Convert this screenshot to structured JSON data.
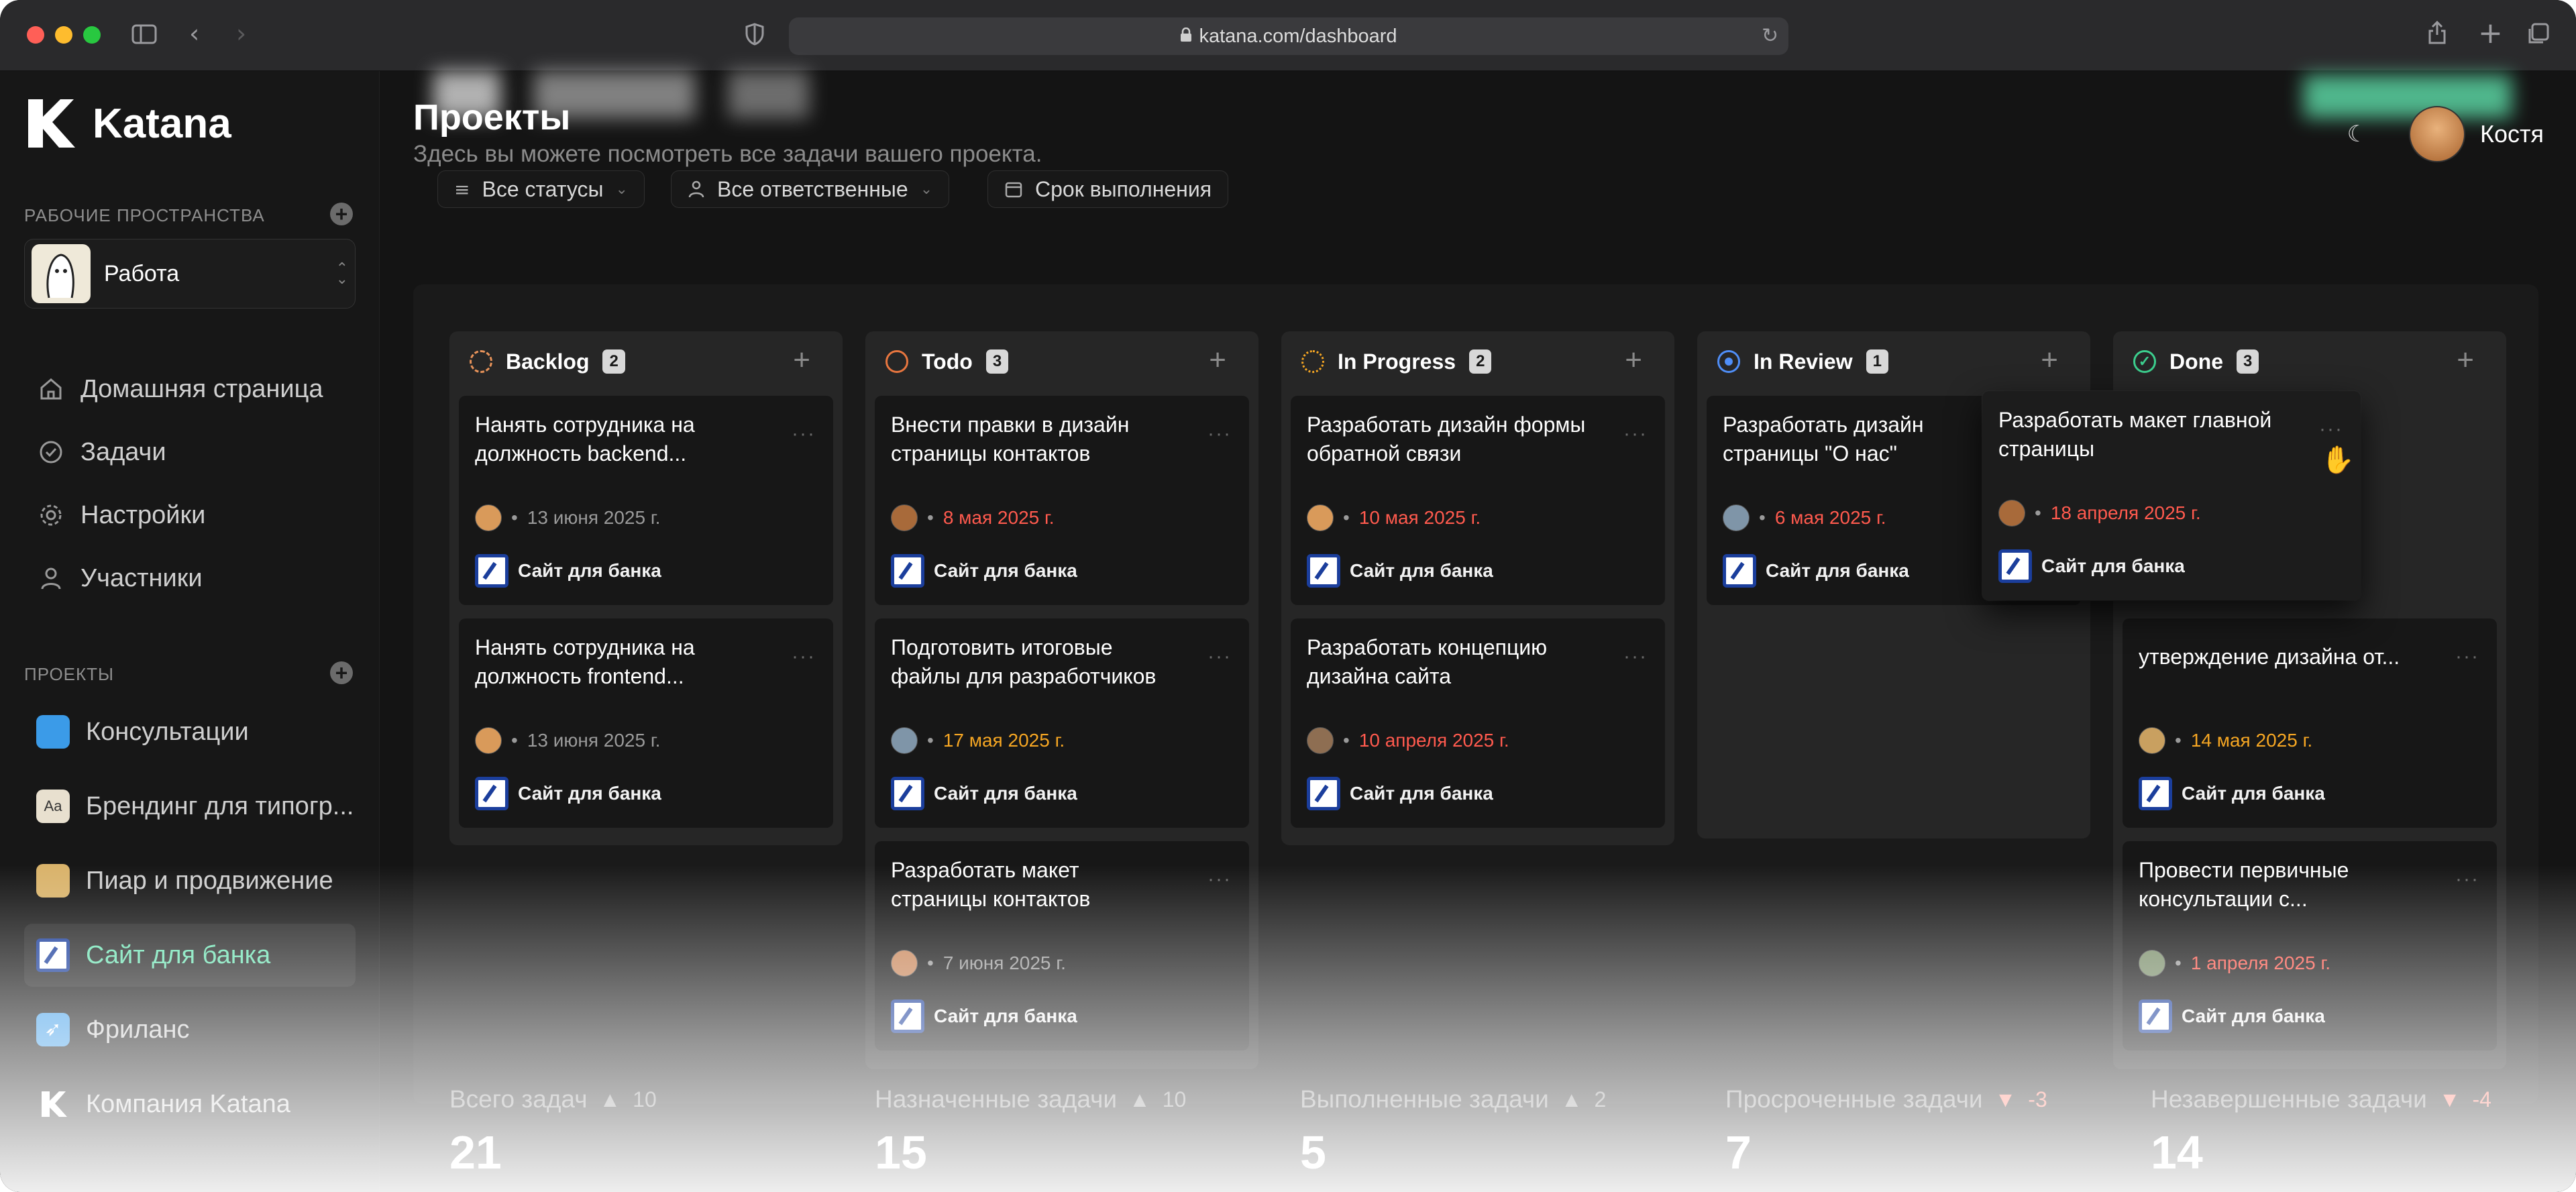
{
  "browser": {
    "url": "katana.com/dashboard",
    "colors": {
      "close": "#ff5f57",
      "minimize": "#febc2e",
      "maximize": "#28c840"
    },
    "icons": [
      "sidebar-toggle-icon",
      "back-icon",
      "forward-icon",
      "shield-icon",
      "lock-icon",
      "reload-icon",
      "share-icon",
      "new-tab-icon",
      "tabs-overview-icon"
    ]
  },
  "sidebar": {
    "brand": "Katana",
    "workspaces_label": "РАБОЧИЕ ПРОСТРАНСТВА",
    "workspace": {
      "name": "Работа"
    },
    "nav": [
      {
        "label": "Домашняя страница",
        "icon": "home-icon"
      },
      {
        "label": "Задачи",
        "icon": "check-circle-icon"
      },
      {
        "label": "Настройки",
        "icon": "gear-icon"
      },
      {
        "label": "Участники",
        "icon": "user-icon"
      }
    ],
    "projects_label": "ПРОЕКТЫ",
    "projects": [
      {
        "label": "Консультации",
        "color": "#3b9be8"
      },
      {
        "label": "Брендинг для типогр...",
        "color": "#e8e0cf"
      },
      {
        "label": "Пиар и продвижение",
        "color": "#d9b36b"
      },
      {
        "label": "Сайт для банка",
        "color": "#1b3e9c",
        "active": true
      },
      {
        "label": "Фриланс",
        "color": "#4aa3ea"
      },
      {
        "label": "Компания Katana",
        "color": "#ffffff"
      }
    ]
  },
  "header": {
    "title": "Проекты",
    "subtitle": "Здесь вы можете посмотреть все задачи вашего проекта.",
    "user_name": "Костя",
    "theme_icon": "moon-icon"
  },
  "filters": {
    "status": "Все статусы",
    "assignee": "Все ответственные",
    "due": "Срок выполнения"
  },
  "columns": [
    {
      "name": "Backlog",
      "count": "2",
      "status_color": "#e8935a",
      "cards": [
        {
          "title": "Нанять сотрудника на должность backend...",
          "date": "13 июня 2025 г.",
          "date_color": "gray",
          "project": "Сайт для банка"
        },
        {
          "title": "Нанять сотрудника на должность frontend...",
          "date": "13 июня 2025 г.",
          "date_color": "gray",
          "project": "Сайт для банка"
        }
      ]
    },
    {
      "name": "Todo",
      "count": "3",
      "status_color": "#e8763f",
      "cards": [
        {
          "title": "Внести правки в дизайн страницы контактов",
          "date": "8 мая 2025 г.",
          "date_color": "red",
          "project": "Сайт для банка"
        },
        {
          "title": "Подготовить итоговые файлы для разработчиков",
          "date": "17 мая 2025 г.",
          "date_color": "orange",
          "project": "Сайт для банка"
        },
        {
          "title": "Разработать макет страницы контактов",
          "date": "7 июня 2025 г.",
          "date_color": "gray",
          "project": "Сайт для банка"
        }
      ]
    },
    {
      "name": "In Progress",
      "count": "2",
      "status_color": "#f5a623",
      "cards": [
        {
          "title": "Разработать дизайн формы обратной связи",
          "date": "10 мая 2025 г.",
          "date_color": "red",
          "project": "Сайт для банка"
        },
        {
          "title": "Разработать концепцию дизайна сайта",
          "date": "10 апреля 2025 г.",
          "date_color": "red",
          "project": "Сайт для банка"
        }
      ]
    },
    {
      "name": "In Review",
      "count": "1",
      "status_color": "#4f8ef7",
      "cards": [
        {
          "title": "Разработать дизайн страницы \"О нас\"",
          "date": "6 мая 2025 г.",
          "date_color": "red",
          "project": "Сайт для банка"
        }
      ]
    },
    {
      "name": "Done",
      "count": "3",
      "status_color": "#3ccf8e",
      "cards": [
        {
          "title": "утверждение дизайна от...",
          "date": "14 мая 2025 г.",
          "date_color": "orange",
          "project": "Сайт для банка"
        },
        {
          "title": "Провести первичные консультации с...",
          "date": "1 апреля 2025 г.",
          "date_color": "red",
          "project": "Сайт для банка"
        }
      ]
    }
  ],
  "dragged_card": {
    "title": "Разработать макет главной страницы",
    "date": "18 апреля 2025 г.",
    "date_color": "red",
    "project": "Сайт для банка"
  },
  "stats": [
    {
      "label": "Всего задач",
      "delta": "10",
      "dir": "up",
      "value": "21"
    },
    {
      "label": "Назначенные задачи",
      "delta": "10",
      "dir": "up",
      "value": "15"
    },
    {
      "label": "Выполненные задачи",
      "delta": "2",
      "dir": "up",
      "value": "5"
    },
    {
      "label": "Просроченные задачи",
      "delta": "-3",
      "dir": "down",
      "value": "7"
    },
    {
      "label": "Незавершенные задачи",
      "delta": "-4",
      "dir": "down",
      "value": "14"
    }
  ]
}
